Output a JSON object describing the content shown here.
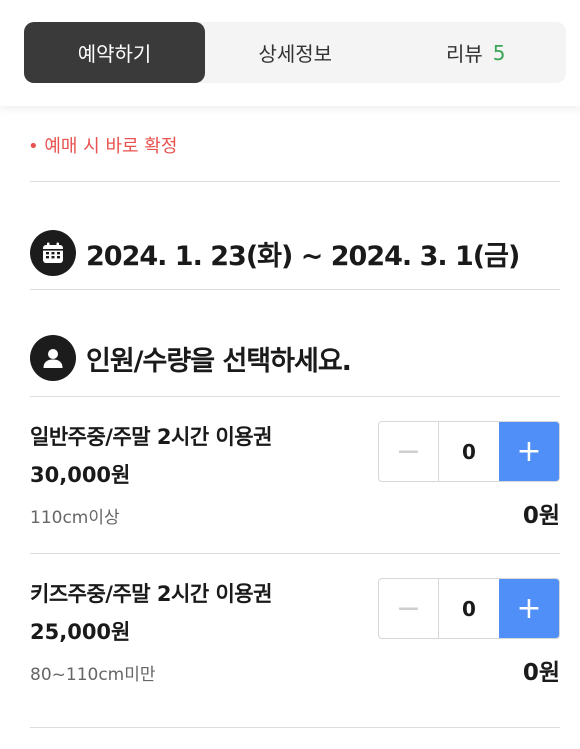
{
  "tabs": [
    {
      "label": "예약하기",
      "active": true
    },
    {
      "label": "상세정보",
      "active": false
    },
    {
      "label": "리뷰",
      "count": "5",
      "active": false
    }
  ],
  "notice": {
    "text": "• 예매 시 바로 확정",
    "color": "#e8534f"
  },
  "date_section": {
    "icon": "calendar-icon",
    "text": "2024. 1. 23(화) ~ 2024. 3. 1(금)"
  },
  "quantity_section": {
    "icon": "person-icon",
    "title": "인원/수량을 선택하세요."
  },
  "items": [
    {
      "name": "일반주중/주말 2시간 이용권",
      "price": "30,000원",
      "note": "110cm이상",
      "quantity": "0",
      "total": "0원"
    },
    {
      "name": "키즈주중/주말 2시간 이용권",
      "price": "25,000원",
      "note": "80~110cm미만",
      "quantity": "0",
      "total": "0원"
    }
  ],
  "colors": {
    "accent": "#4f8ff7",
    "review_count": "#3aa655",
    "active_tab": "#3a3a3a"
  }
}
